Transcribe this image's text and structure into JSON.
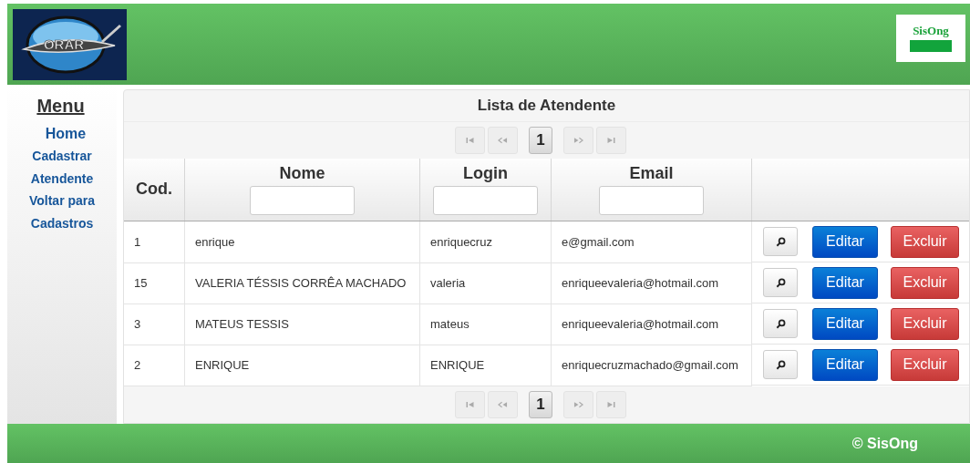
{
  "header": {
    "logo_text": "ORAR",
    "brand": "SisOng"
  },
  "sidebar": {
    "title": "Menu",
    "items": [
      {
        "label": "Home",
        "kind": "large"
      },
      {
        "label": "Cadastrar Atendente",
        "kind": "small"
      },
      {
        "label": "Voltar para Cadastros",
        "kind": "small"
      }
    ]
  },
  "panel": {
    "title": "Lista de Atendente",
    "paginator_top": {
      "pages": [
        {
          "label": "1",
          "selected": true
        }
      ],
      "first_disabled": true,
      "prev_disabled": true,
      "next_disabled": true,
      "last_disabled": true
    },
    "table": {
      "columns": [
        {
          "label": "Cod.",
          "filter": false
        },
        {
          "label": "Nome",
          "filter": true
        },
        {
          "label": "Login",
          "filter": true
        },
        {
          "label": "Email",
          "filter": true
        }
      ],
      "rows": [
        {
          "cod": "1",
          "nome": "enrique",
          "login": "enriquecruz",
          "email": "e@gmail.com",
          "actions": [
            "Editar",
            "Excluir"
          ]
        },
        {
          "cod": "15",
          "nome": "VALERIA TÉSSIS CORRÊA MACHADO",
          "login": "valeria",
          "email": "enriqueevaleria@hotmail.com",
          "actions": [
            "Editar",
            "Excluir"
          ]
        },
        {
          "cod": "3",
          "nome": "MATEUS TESSIS",
          "login": "mateus",
          "email": "enriqueevaleria@hotmail.com",
          "actions": [
            "Editar",
            "Excluir"
          ]
        },
        {
          "cod": "2",
          "nome": "ENRIQUE",
          "login": "ENRIQUE",
          "email": "enriquecruzmachado@gmail.com",
          "actions": [
            "Editar",
            "Excluir"
          ]
        }
      ]
    },
    "paginator_bottom": {
      "pages": [
        {
          "label": "1",
          "selected": true
        }
      ],
      "first_disabled": true,
      "prev_disabled": true,
      "next_disabled": true,
      "last_disabled": true
    }
  },
  "footer": {
    "text": "© SisOng"
  }
}
